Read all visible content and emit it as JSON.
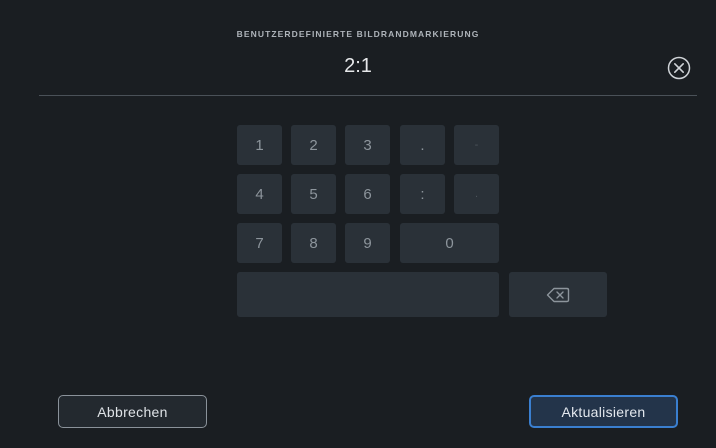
{
  "header": {
    "title": "BENUTZERDEFINIERTE BILDRANDMARKIERUNG",
    "value": "2:1"
  },
  "keypad": {
    "row1": [
      "1",
      "2",
      "3",
      ".",
      "-"
    ],
    "row2": [
      "4",
      "5",
      "6",
      ":",
      "."
    ],
    "row3": [
      "7",
      "8",
      "9",
      "0"
    ]
  },
  "icons": {
    "close": "close-circle-icon",
    "backspace": "backspace-icon"
  },
  "footer": {
    "cancel_label": "Abbrechen",
    "update_label": "Aktualisieren"
  },
  "colors": {
    "background": "#1a1e22",
    "key": "#2a3138",
    "accent": "#3a7fd0"
  }
}
